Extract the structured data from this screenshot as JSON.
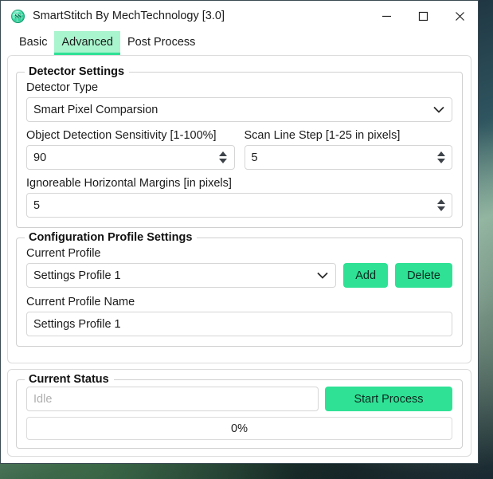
{
  "window": {
    "title": "SmartStitch By MechTechnology [3.0]",
    "icon": "app-globe-icon",
    "controls": {
      "minimize": "minimize-icon",
      "maximize": "maximize-icon",
      "close": "close-icon"
    }
  },
  "tabs": [
    {
      "label": "Basic",
      "active": false
    },
    {
      "label": "Advanced",
      "active": true
    },
    {
      "label": "Post Process",
      "active": false
    }
  ],
  "detector_settings": {
    "title": "Detector Settings",
    "detector_type": {
      "label": "Detector Type",
      "value": "Smart Pixel Comparsion"
    },
    "sensitivity": {
      "label": "Object Detection Sensitivity  [1-100%]",
      "value": "90"
    },
    "scan_line_step": {
      "label": "Scan Line Step [1-25 in pixels]",
      "value": "5"
    },
    "margins": {
      "label": "Ignoreable Horizontal Margins [in pixels]",
      "value": "5"
    }
  },
  "profile_settings": {
    "title": "Configuration Profile Settings",
    "current_profile": {
      "label": "Current Profile",
      "value": "Settings Profile 1"
    },
    "add_label": "Add",
    "delete_label": "Delete",
    "current_profile_name": {
      "label": "Current Profile Name",
      "value": "Settings Profile 1"
    }
  },
  "status": {
    "title": "Current Status",
    "field_placeholder": "Idle",
    "field_value": "",
    "start_label": "Start Process",
    "progress_text": "0%",
    "progress_percent": 0
  },
  "colors": {
    "accent_green": "#2fe195",
    "tab_active_bg": "#a9f5ce",
    "border": "#d6d6d6",
    "text": "#1b1b1b"
  }
}
